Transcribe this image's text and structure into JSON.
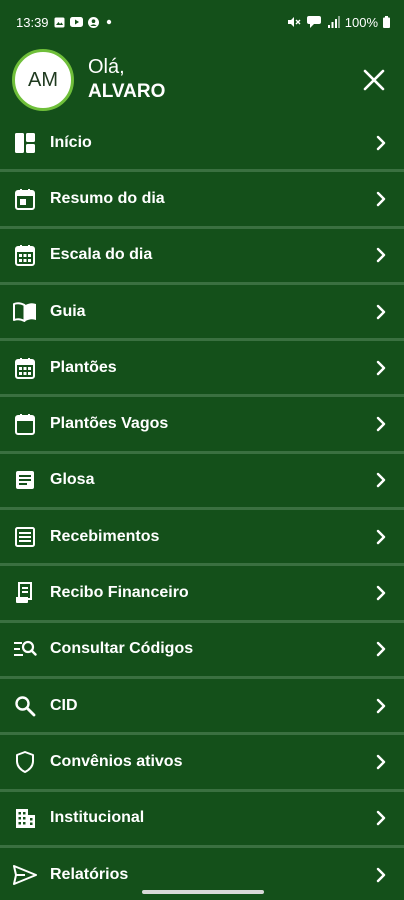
{
  "status_bar": {
    "time": "13:39",
    "battery": "100%"
  },
  "header": {
    "avatar_initials": "AM",
    "greeting": "Olá,",
    "user_name": "ALVARO"
  },
  "menu": {
    "items": [
      {
        "label": "Início",
        "icon": "dashboard-icon"
      },
      {
        "label": "Resumo do dia",
        "icon": "calendar-day-icon"
      },
      {
        "label": "Escala do dia",
        "icon": "calendar-grid-icon"
      },
      {
        "label": "Guia",
        "icon": "book-open-icon"
      },
      {
        "label": "Plantões",
        "icon": "calendar-grid-icon"
      },
      {
        "label": "Plantões Vagos",
        "icon": "calendar-blank-icon"
      },
      {
        "label": "Glosa",
        "icon": "document-lines-icon"
      },
      {
        "label": "Recebimentos",
        "icon": "list-lines-icon"
      },
      {
        "label": "Recibo Financeiro",
        "icon": "receipt-icon"
      },
      {
        "label": "Consultar Códigos",
        "icon": "search-list-icon"
      },
      {
        "label": "CID",
        "icon": "search-icon"
      },
      {
        "label": "Convênios ativos",
        "icon": "shield-icon"
      },
      {
        "label": "Institucional",
        "icon": "building-icon"
      },
      {
        "label": "Relatórios",
        "icon": "send-icon"
      }
    ]
  },
  "colors": {
    "background": "#14501a",
    "divider": "#3a7040",
    "avatar_ring": "#6fbf3a"
  }
}
